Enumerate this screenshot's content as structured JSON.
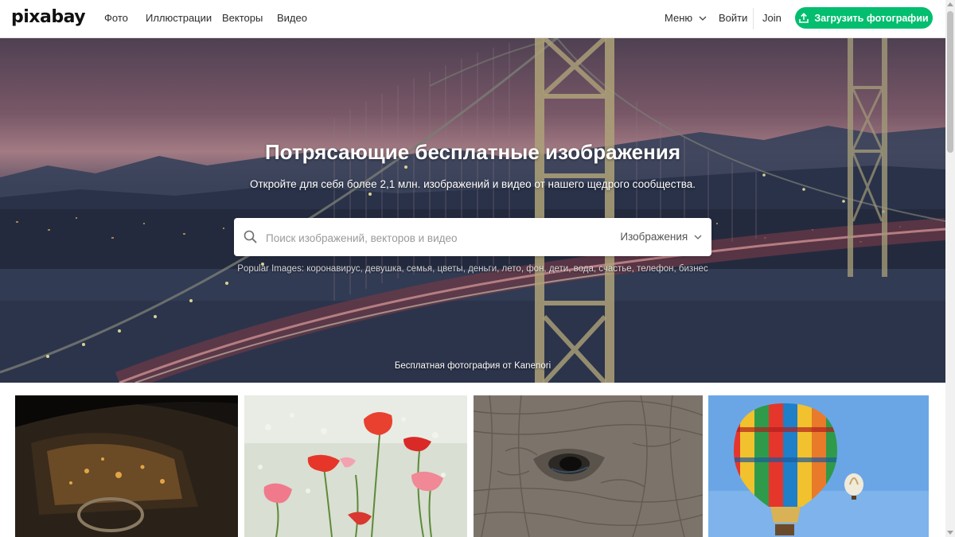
{
  "header": {
    "logo": "pixabay",
    "nav": [
      "Фото",
      "Иллюстрации",
      "Векторы",
      "Видео"
    ],
    "menu_label": "Меню",
    "login_label": "Войти",
    "join_label": "Join",
    "upload_label": "Загрузить фотографии"
  },
  "hero": {
    "title": "Потрясающие бесплатные изображения",
    "subtitle": "Откройте для себя более 2,1 млн. изображений и видео от нашего щедрого сообщества.",
    "search": {
      "placeholder": "Поиск изображений, векторов и видео",
      "value": "",
      "type_label": "Изображения"
    },
    "popular_prefix": "Popular Images: ",
    "popular_tags": [
      "коронавирус",
      "девушка",
      "семья",
      "цветы",
      "деньги",
      "лето",
      "фон",
      "дети",
      "вода",
      "счастье",
      "телефон",
      "бизнес"
    ],
    "credit": "Бесплатная фотография от Kanenori"
  },
  "gallery": [
    {
      "subject": "vintage car interior at night"
    },
    {
      "subject": "red and pink poppies"
    },
    {
      "subject": "elephant eye close-up"
    },
    {
      "subject": "hot air balloons"
    }
  ],
  "colors": {
    "accent": "#02be6e",
    "text": "#2d2d2d"
  },
  "icons": {
    "search": "magnifier",
    "upload": "upload-arrow",
    "chevron": "chevron-down"
  }
}
